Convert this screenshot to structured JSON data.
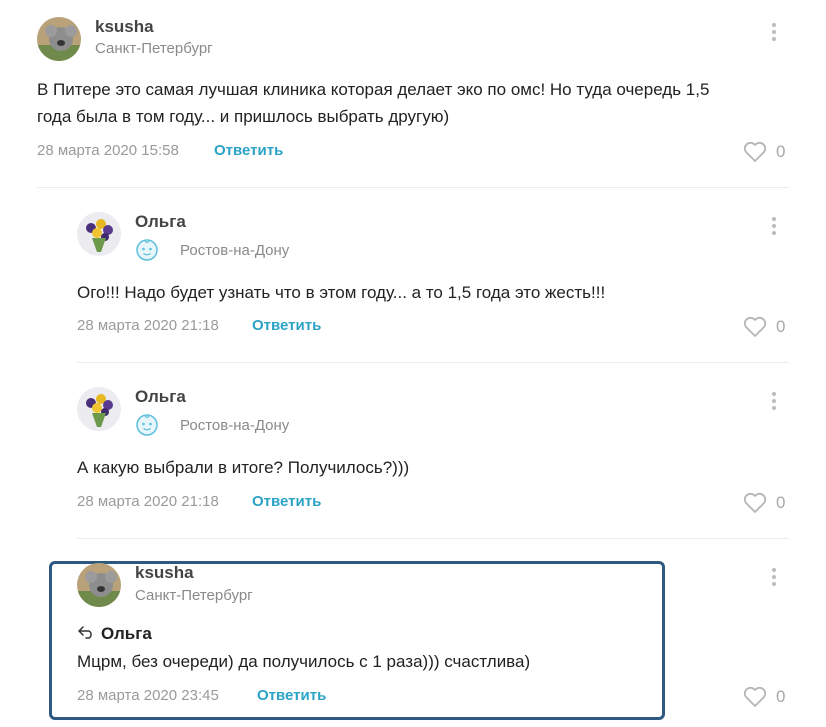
{
  "comments": [
    {
      "author": "ksusha",
      "city": "Санкт-Петербург",
      "text_line1": "В Питере это самая лучшая клиника которая делает эко по омс! Но туда очередь 1,5",
      "text_line2": "года была в том году... и пришлось выбрать другую)",
      "date": "28 марта 2020 15:58",
      "reply_label": "Ответить",
      "likes": "0"
    },
    {
      "author": "Ольга",
      "city": "Ростов-на-Дону",
      "text": "Ого!!! Надо будет узнать что в этом году... а то 1,5 года это жесть!!!",
      "date": "28 марта 2020 21:18",
      "reply_label": "Ответить",
      "likes": "0"
    },
    {
      "author": "Ольга",
      "city": "Ростов-на-Дону",
      "text": "А какую выбрали в итоге? Получилось?)))",
      "date": "28 марта 2020 21:18",
      "reply_label": "Ответить",
      "likes": "0"
    },
    {
      "author": "ksusha",
      "city": "Санкт-Петербург",
      "reply_to": "Ольга",
      "text": "Мцрм, без очереди) да получилось с 1 раза))) счастлива)",
      "date": "28 марта 2020 23:45",
      "reply_label": "Ответить",
      "likes": "0"
    }
  ],
  "icons": {
    "more": "vertical-dots-icon",
    "like": "heart-icon",
    "reply_arrow": "reply-arrow-icon",
    "baby_badge": "baby-face-icon"
  },
  "colors": {
    "accent": "#2aa3c7",
    "highlight_border": "#2e5a82",
    "muted": "#9a9a9a"
  }
}
